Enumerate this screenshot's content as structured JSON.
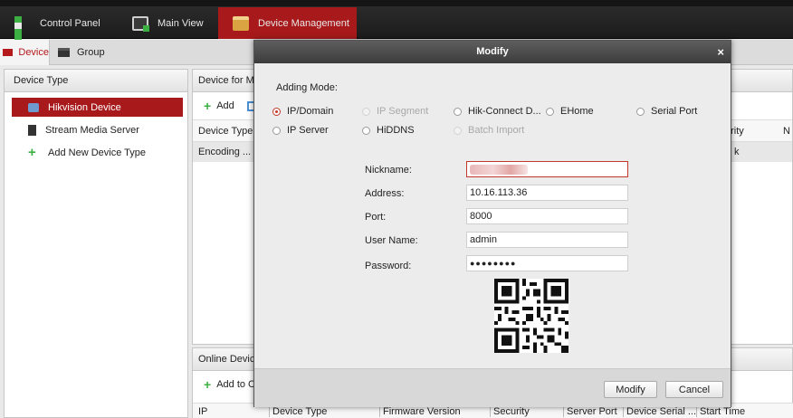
{
  "nav": {
    "tabs": [
      {
        "label": "Control Panel"
      },
      {
        "label": "Main View"
      },
      {
        "label": "Device Management"
      }
    ]
  },
  "subnav": {
    "tabs": [
      {
        "label": "Device"
      },
      {
        "label": "Group"
      }
    ]
  },
  "device_type_panel": {
    "title": "Device Type",
    "items": [
      {
        "label": "Hikvision Device"
      },
      {
        "label": "Stream Media Server"
      },
      {
        "label": "Add New Device Type"
      }
    ]
  },
  "device_panel": {
    "title": "Device for Ma",
    "add_label": "Add",
    "columns": [
      "Device Type",
      "urity",
      "N"
    ],
    "row": {
      "device_type": "Encoding ...",
      "security": "k"
    }
  },
  "online_panel": {
    "title": "Online Device",
    "add_label": "Add to Cl",
    "columns": [
      "IP",
      "Device Type",
      "Firmware Version",
      "Security",
      "Server Port",
      "Device Serial ...",
      "Start Time"
    ]
  },
  "modal": {
    "title": "Modify",
    "close": "×",
    "adding_mode_label": "Adding Mode:",
    "modes": [
      {
        "label": "IP/Domain"
      },
      {
        "label": "IP Segment"
      },
      {
        "label": "Hik-Connect D..."
      },
      {
        "label": "EHome"
      },
      {
        "label": "Serial Port"
      },
      {
        "label": "IP Server"
      },
      {
        "label": "HiDDNS"
      },
      {
        "label": "Batch Import"
      }
    ],
    "fields": {
      "nickname_label": "Nickname:",
      "address_label": "Address:",
      "address_value": "10.16.113.36",
      "port_label": "Port:",
      "port_value": "8000",
      "username_label": "User Name:",
      "username_value": "admin",
      "password_label": "Password:",
      "password_value": "●●●●●●●●"
    },
    "buttons": {
      "modify": "Modify",
      "cancel": "Cancel"
    }
  }
}
